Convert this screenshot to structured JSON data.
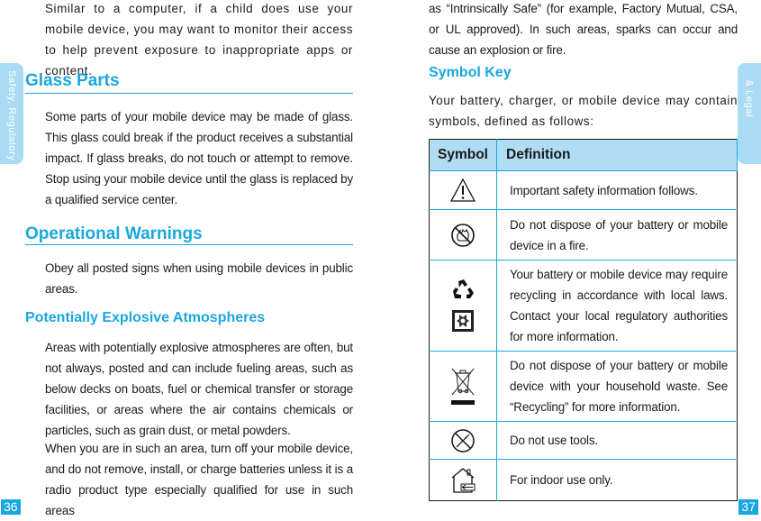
{
  "left_page": {
    "side_tab": "Safety, Regulatory",
    "page_number": "36",
    "intro_paragraph": "Similar to a computer, if a child does use your mobile device, you may want to monitor their access to help prevent exposure to inappropriate apps or content.",
    "sections": [
      {
        "title": "Glass Parts",
        "paragraphs": [
          "Some parts of your mobile device may be made of glass. This glass could break if the product receives a substantial impact. If glass breaks, do not touch or attempt to remove. Stop using your mobile device until the glass is replaced by a qualified service center."
        ]
      },
      {
        "title": "Operational Warnings",
        "paragraphs": [
          "Obey all posted signs when using mobile devices in public areas."
        ]
      }
    ],
    "subsection": {
      "title": "Potentially Explosive Atmospheres",
      "paragraphs": [
        "Areas with potentially explosive atmospheres are often, but not always, posted and can include fueling areas, such as below decks on boats, fuel or chemical transfer or storage facilities, or areas where the air contains chemicals or particles, such as grain dust, or metal powders.",
        "When you are in such an area, turn off your mobile device, and do not remove, install, or charge batteries unless it is a radio product type especially qualified for use in such areas"
      ]
    }
  },
  "right_page": {
    "side_tab": "& Legal",
    "page_number": "37",
    "continued_paragraph": "as “Intrinsically Safe” (for example, Factory Mutual, CSA, or UL approved). In such areas, sparks can occur and cause an explosion or fire.",
    "symbol_key": {
      "title": "Symbol Key",
      "intro": "Your battery, charger, or mobile device may contain symbols, defined as follows:",
      "table": {
        "headers": [
          "Symbol",
          "Definition"
        ],
        "rows": [
          {
            "icons": [
              "warning-triangle"
            ],
            "definition": "Important safety information follows."
          },
          {
            "icons": [
              "no-fire"
            ],
            "definition": "Do not dispose of your battery or mobile device in a fire."
          },
          {
            "icons": [
              "recycle",
              "battery-recycle"
            ],
            "definition": "Your battery or mobile device may require recycling in accordance with local laws. Contact your local regulatory authorities for more information."
          },
          {
            "icons": [
              "crossed-bin"
            ],
            "definition": "Do not dispose of your battery or mobile device with your household waste. See “Recycling” for more information."
          },
          {
            "icons": [
              "no-tools"
            ],
            "definition": "Do not use tools."
          },
          {
            "icons": [
              "indoor-use"
            ],
            "definition": "For indoor use only."
          }
        ]
      }
    }
  },
  "colors": {
    "accent": "#1aa7e0",
    "tab_background": "#a9dcf4",
    "table_header": "#b0dcf4",
    "text": "#1a1a1a"
  }
}
